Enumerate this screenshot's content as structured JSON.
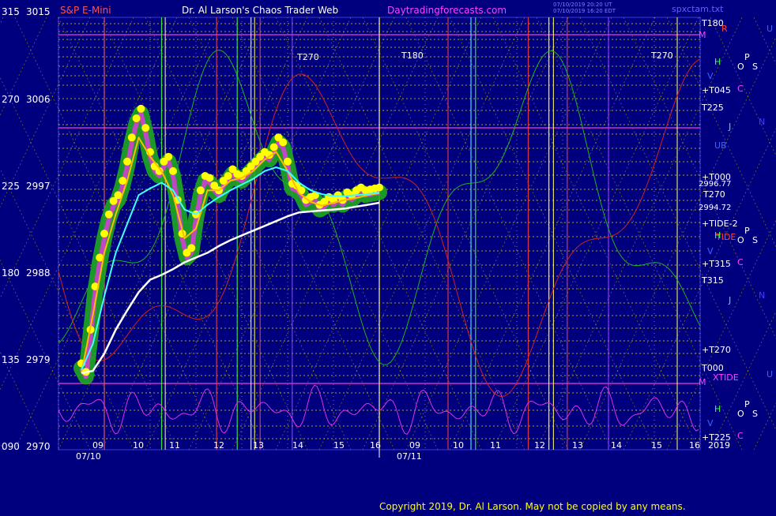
{
  "header": {
    "instrument": "S&P E-Mini",
    "site": "Dr. Al Larson's Chaos Trader Web",
    "url": "Daytradingforecasts.com",
    "stamp_1": "07/10/2019 20:20 UT",
    "stamp_2": "07/10/2019 16:20 EDT",
    "file": "spxctam.txt"
  },
  "copyright": "Copyright 2019, Dr. Al Larson. May not be copied by any means.",
  "colors": {
    "background": "#00007f",
    "price_bar_glow": "#1fa81f",
    "price_bar_dots": "#ffff00",
    "short_avg": "#ffbb00",
    "medium_avg": "#40ffff",
    "long_avg": "#ffffff",
    "lunar_osc": "#e030e0",
    "sun_osc": "#20b020",
    "mars_osc": "#d02020",
    "grid_yellow": "#d8d800",
    "separator": "#ffffff"
  },
  "chart_data": {
    "type": "line",
    "title": "S&P E-Mini",
    "left_axis_angle_labels": [
      "315",
      "270",
      "225",
      "180",
      "135",
      "090"
    ],
    "left_axis_price_labels": [
      "3015",
      "3006",
      "2997",
      "2988",
      "2979",
      "2970"
    ],
    "ylim": [
      2970,
      3015
    ],
    "x_tick_labels_day1": [
      "09",
      "10",
      "11",
      "12",
      "13",
      "14",
      "15",
      "16"
    ],
    "x_tick_labels_day2": [
      "09",
      "10",
      "11",
      "12",
      "13",
      "14",
      "15",
      "16"
    ],
    "date_labels": [
      "07/10",
      "07/11"
    ],
    "price_readouts": [
      "2996.77",
      "2994.72"
    ],
    "right_labels": [
      "T180",
      "+T045",
      "T225",
      "+T000",
      "T270",
      "+TIDE-2",
      "TIDE",
      "+T315",
      "T315",
      "+T270",
      "T000",
      "XTIDE",
      "+T225",
      "2019"
    ],
    "planet_glyphs": [
      "M",
      "R",
      "U",
      "H",
      "O",
      "P",
      "S",
      "V",
      "C",
      "J",
      "N",
      "UB"
    ],
    "in_chart_labels": [
      "T270",
      "T180",
      "T270"
    ],
    "price_series": {
      "name": "",
      "x_hours": [
        9.5,
        9.6,
        9.7,
        9.8,
        9.9,
        10.0,
        10.1,
        10.2,
        10.3,
        10.4,
        10.5,
        10.6,
        10.7,
        10.8,
        10.9,
        11.0,
        11.1,
        11.2,
        11.3,
        11.4,
        11.5,
        11.6,
        11.7,
        11.8,
        11.9,
        12.0,
        12.1,
        12.2,
        12.3,
        12.4,
        12.5,
        12.6,
        12.7,
        12.8,
        12.9,
        13.0,
        13.1,
        13.2,
        13.3,
        13.4,
        13.5,
        13.6,
        13.7,
        13.8,
        13.9,
        14.0,
        14.1,
        14.2,
        14.3,
        14.4,
        14.5,
        14.6,
        14.7,
        14.8,
        14.9,
        15.0,
        15.1,
        15.2,
        15.3,
        15.4,
        15.5,
        15.6,
        15.7,
        15.8,
        15.9,
        16.0
      ],
      "values": [
        2978.5,
        2977.6,
        2982.0,
        2986.5,
        2989.5,
        2992.0,
        2994.0,
        2995.4,
        2996.0,
        2997.5,
        2999.5,
        3002.0,
        3004.0,
        3005.0,
        3003.0,
        3000.5,
        2999.0,
        2998.5,
        2999.5,
        3000.0,
        2998.5,
        2995.5,
        2992.0,
        2990.0,
        2990.5,
        2994.0,
        2996.5,
        2998.0,
        2997.8,
        2997.0,
        2996.5,
        2997.5,
        2998.0,
        2998.7,
        2998.2,
        2998.0,
        2998.5,
        2999.0,
        2999.5,
        3000.0,
        3000.5,
        3000.2,
        3001.0,
        3002.0,
        3001.5,
        2999.5,
        2997.2,
        2997.0,
        2996.5,
        2995.5,
        2995.8,
        2996.0,
        2995.0,
        2995.3,
        2995.8,
        2995.5,
        2996.0,
        2995.5,
        2996.3,
        2996.0,
        2996.5,
        2996.8,
        2996.5,
        2996.6,
        2996.7,
        2996.8
      ]
    },
    "short_avg": {
      "x_hours": [
        9.5,
        9.75,
        10.0,
        10.25,
        10.5,
        10.75,
        11.0,
        11.25,
        11.5,
        11.75,
        12.0,
        12.25,
        12.5,
        12.75,
        13.0,
        13.25,
        13.5,
        13.75,
        14.0,
        14.25,
        14.5,
        14.75,
        15.0,
        15.25,
        15.5,
        15.75,
        16.0
      ],
      "values": [
        2978.0,
        2984.0,
        2990.5,
        2994.5,
        2998.0,
        3002.5,
        3000.5,
        2999.0,
        2996.5,
        2992.0,
        2993.0,
        2997.0,
        2997.0,
        2998.0,
        2998.3,
        2999.0,
        3000.2,
        3001.0,
        2999.0,
        2996.7,
        2995.8,
        2995.4,
        2995.7,
        2996.0,
        2996.2,
        2996.5,
        2996.7
      ]
    },
    "medium_avg": {
      "x_hours": [
        9.5,
        9.75,
        10.0,
        10.25,
        10.5,
        10.75,
        11.0,
        11.25,
        11.5,
        11.75,
        12.0,
        12.25,
        12.5,
        12.75,
        13.0,
        13.25,
        13.5,
        13.75,
        14.0,
        14.25,
        14.5,
        14.75,
        15.0,
        15.25,
        15.5,
        15.75,
        16.0
      ],
      "values": [
        2978.3,
        2981.0,
        2986.0,
        2990.5,
        2993.5,
        2996.5,
        2997.2,
        2997.8,
        2997.0,
        2995.0,
        2994.5,
        2995.5,
        2996.3,
        2997.0,
        2997.6,
        2998.2,
        2999.0,
        2999.4,
        2999.0,
        2997.8,
        2997.0,
        2996.6,
        2996.4,
        2996.4,
        2996.5,
        2996.6,
        2996.8
      ]
    },
    "long_avg": {
      "x_hours": [
        9.5,
        9.75,
        10.0,
        10.25,
        10.5,
        10.75,
        11.0,
        11.25,
        11.5,
        11.75,
        12.0,
        12.25,
        12.5,
        12.75,
        13.0,
        13.25,
        13.5,
        13.75,
        14.0,
        14.25,
        14.5,
        14.75,
        15.0,
        15.25,
        15.5,
        15.75,
        16.0
      ],
      "values": [
        2978.0,
        2978.2,
        2980.0,
        2982.5,
        2984.5,
        2986.4,
        2987.7,
        2988.2,
        2988.8,
        2989.5,
        2990.0,
        2990.5,
        2991.2,
        2991.8,
        2992.3,
        2992.8,
        2993.3,
        2993.8,
        2994.3,
        2994.7,
        2994.8,
        2994.9,
        2995.0,
        2995.1,
        2995.3,
        2995.5,
        2995.7
      ]
    },
    "vertical_markers": [
      {
        "day": 1,
        "hour": 10.0,
        "color": "#ff6060"
      },
      {
        "day": 1,
        "hour": 11.25,
        "color": "#40ff40"
      },
      {
        "day": 1,
        "hour": 11.33,
        "color": "#ffff60"
      },
      {
        "day": 1,
        "hour": 12.45,
        "color": "#ff4040"
      },
      {
        "day": 1,
        "hour": 12.9,
        "color": "#40ff40"
      },
      {
        "day": 1,
        "hour": 13.2,
        "color": "#ffffff"
      },
      {
        "day": 1,
        "hour": 13.28,
        "color": "#ffff60"
      },
      {
        "day": 1,
        "hour": 13.4,
        "color": "#ff4040"
      },
      {
        "day": 1,
        "hour": 14.1,
        "color": "#a040ff"
      },
      {
        "day": 2,
        "hour": 9.0,
        "color": "#ffff60"
      },
      {
        "day": 2,
        "hour": 10.5,
        "color": "#ff4040"
      },
      {
        "day": 2,
        "hour": 11.0,
        "color": "#40ffff"
      },
      {
        "day": 2,
        "hour": 11.1,
        "color": "#40ff40"
      },
      {
        "day": 2,
        "hour": 12.25,
        "color": "#ff4040"
      },
      {
        "day": 2,
        "hour": 12.7,
        "color": "#ffffff"
      },
      {
        "day": 2,
        "hour": 12.8,
        "color": "#ffff60"
      },
      {
        "day": 2,
        "hour": 13.1,
        "color": "#ff4040"
      },
      {
        "day": 2,
        "hour": 14.0,
        "color": "#a040ff"
      },
      {
        "day": 2,
        "hour": 15.5,
        "color": "#ffff60"
      }
    ]
  }
}
